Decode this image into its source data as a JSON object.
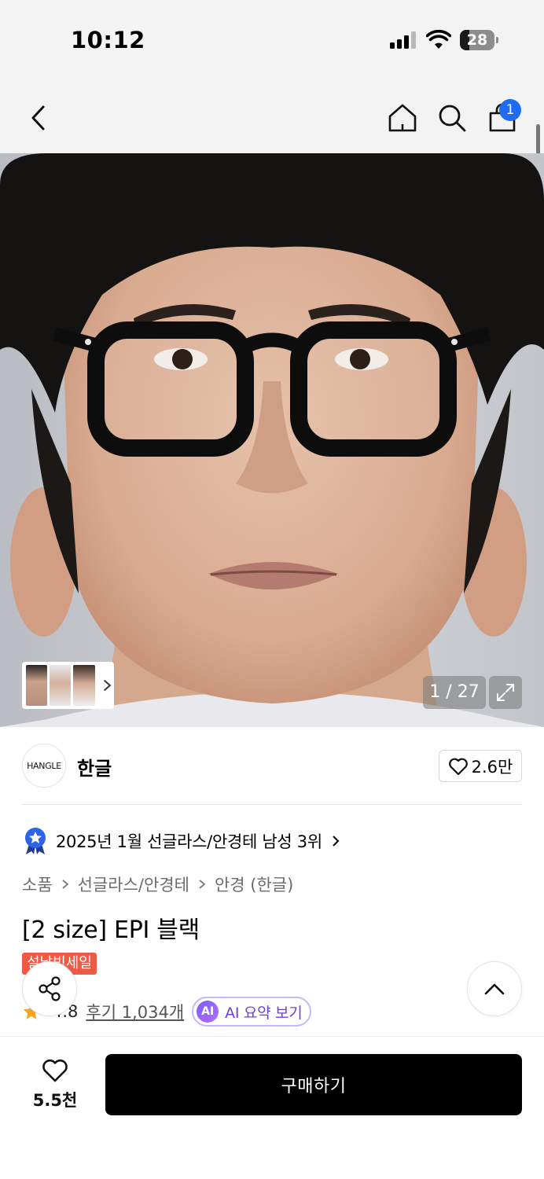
{
  "status_bar": {
    "time": "10:12",
    "battery": "28",
    "battery_level": 0.28
  },
  "header": {
    "cart_count": "1",
    "icons": [
      "back-chevron-icon",
      "home-icon",
      "search-icon",
      "shopping-bag-icon"
    ]
  },
  "gallery": {
    "counter": "1 / 27",
    "expand_icon": "expand-icon"
  },
  "brand": {
    "logo_text": "HANGLE",
    "name": "한글",
    "likes": "2.6만"
  },
  "ranking": {
    "text": "2025년 1월 선글라스/안경테 남성 3위"
  },
  "breadcrumb": [
    "소품",
    "선글라스/안경테",
    "안경 (한글)"
  ],
  "product": {
    "title": "[2 size] EPI 블랙",
    "sale_badge": "설날빅세일",
    "rating": "4.8",
    "reviews": "후기 1,034개",
    "ai_chip": "AI",
    "ai_summary": "AI 요약 보기"
  },
  "bottom_bar": {
    "wish_count": "5.5천",
    "buy_label": "구매하기"
  },
  "colors": {
    "accent_blue": "#1f6cf3",
    "sale_red": "#f05a45",
    "ai_purple": "#6a3fe0",
    "star": "#f5a623"
  }
}
